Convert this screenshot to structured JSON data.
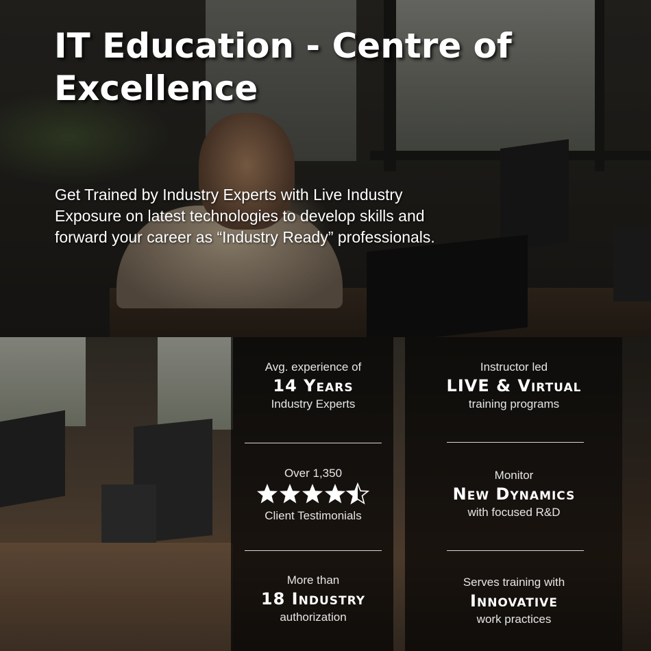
{
  "hero": {
    "title": "IT Education - Centre of Excellence",
    "subtitle": "Get Trained by Industry Experts with Live Industry Exposure on latest technologies to develop skills and forward your career as “Industry Ready” professionals."
  },
  "stats_left": [
    {
      "top": "Avg. experience of",
      "highlight": "14 Years",
      "bottom": "Industry Experts"
    },
    {
      "top": "Over 1,350",
      "rating": 4.5,
      "rating_max": 5,
      "bottom": "Client Testimonials"
    },
    {
      "top": "More than",
      "highlight": "18 Industry",
      "bottom": "authorization"
    }
  ],
  "stats_right": [
    {
      "top": "Instructor led",
      "highlight": "LIVE & Virtual",
      "bottom": "training programs"
    },
    {
      "top": "Monitor",
      "highlight": "New Dynamics",
      "bottom": "with focused R&D"
    },
    {
      "top": "Serves training with",
      "highlight": "Innovative",
      "bottom": "work practices"
    }
  ],
  "colors": {
    "overlay": "#000000",
    "text": "#ffffff",
    "divider": "#d8d8d8"
  }
}
